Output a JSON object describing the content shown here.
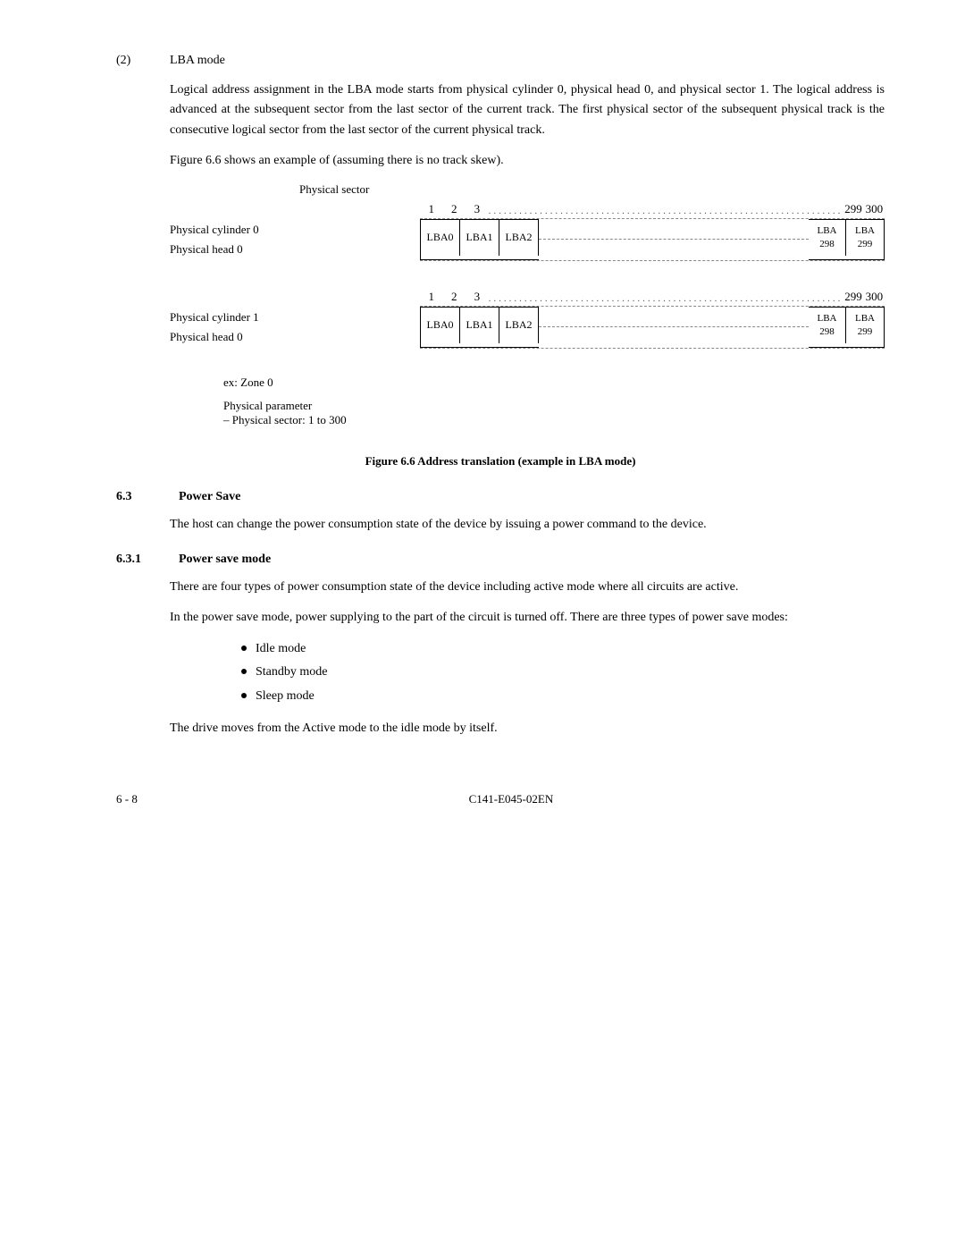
{
  "section": {
    "number": "(2)",
    "title": "LBA mode"
  },
  "paragraphs": {
    "p1": "Logical address assignment in the LBA mode starts from physical cylinder 0, physical head 0, and physical sector 1.  The logical address is advanced at the subsequent sector from the last sector of the current track.  The first physical sector of the subsequent physical track is the consecutive logical sector from the last sector of the current physical track.",
    "p2": "Figure 6.6 shows an example of (assuming there is no track skew).",
    "figure_caption": "Figure 6.6   Address translation (example in LBA mode)"
  },
  "diagram": {
    "title": "Physical sector",
    "col_headers": [
      "1",
      "2",
      "3"
    ],
    "col_dots": ".............................................",
    "col_299": "299",
    "col_300": "300",
    "diagrams": [
      {
        "cylinder_label": "Physical cylinder 0",
        "head_label": "Physical head 0",
        "cells": [
          "LBA0",
          "LBA1",
          "LBA2"
        ],
        "end_cells": [
          [
            "LBA",
            "298"
          ],
          [
            "LBA",
            "299"
          ]
        ]
      },
      {
        "cylinder_label": "Physical cylinder 1",
        "head_label": "Physical head 0",
        "cells": [
          "LBA0",
          "LBA1",
          "LBA2"
        ],
        "end_cells": [
          [
            "LBA",
            "298"
          ],
          [
            "LBA",
            "299"
          ]
        ]
      }
    ],
    "zone_label": "ex:  Zone 0",
    "physical_param_label": "Physical parameter",
    "physical_sector_range": "– Physical sector:  1 to 300"
  },
  "section_6_3": {
    "number": "6.3",
    "title": "Power Save",
    "paragraph": "The host can change the power consumption state of the device by issuing a power command to the device."
  },
  "section_6_3_1": {
    "number": "6.3.1",
    "title": "Power save mode",
    "p1": "There are four types of power consumption state of the device including active mode where all circuits are active.",
    "p2": "In the power save mode, power supplying to the part of the circuit is turned off.  There are three types of power save modes:",
    "bullet_items": [
      "Idle mode",
      "Standby mode",
      "Sleep mode"
    ],
    "p3": "The drive moves from the Active mode to the idle mode by itself."
  },
  "footer": {
    "left": "6 - 8",
    "center": "C141-E045-02EN"
  }
}
